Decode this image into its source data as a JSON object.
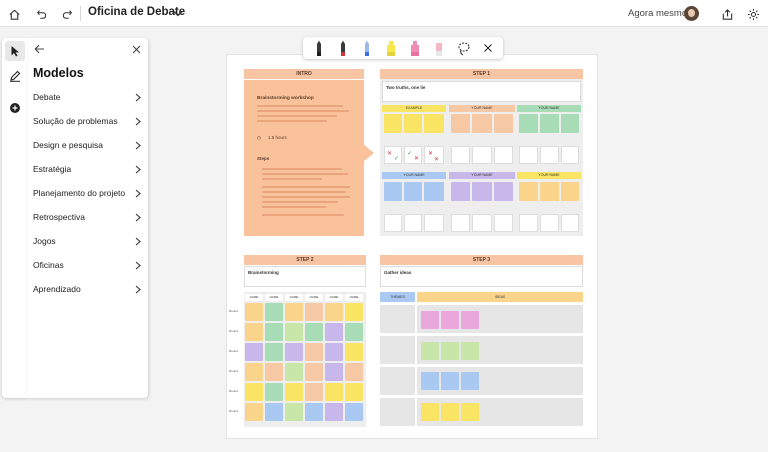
{
  "header": {
    "title": "Oficina de Debate",
    "saved_status": "Agora mesmo",
    "icons": [
      "home-icon",
      "undo-icon",
      "redo-icon",
      "chevron-down-icon",
      "share-icon",
      "gear-icon"
    ]
  },
  "toolrail": {
    "icons": [
      "select-arrow-icon",
      "pen-icon",
      "add-icon"
    ]
  },
  "panel": {
    "title": "Modelos",
    "categories": [
      "Debate",
      "Solução de problemas",
      "Design e pesquisa",
      "Estratégia",
      "Planejamento do projeto",
      "Retrospectiva",
      "Jogos",
      "Oficinas",
      "Aprendizado"
    ]
  },
  "pen_toolbar": {
    "tools": [
      "black-pen",
      "red-pen",
      "multicolor-pen",
      "yellow-highlighter",
      "pink-highlighter",
      "eraser",
      "lasso-select-icon",
      "close-icon"
    ],
    "colors": [
      "#1d1d1d",
      "#d13438",
      "#3f6fd8",
      "#f4e84a",
      "#f08bb7",
      "#f2b8c6"
    ]
  },
  "board": {
    "intro_header": "INTRO",
    "intro_title": "Brainstorming workshop",
    "intro_time": "1.5 hours",
    "intro_steps_label": "Steps",
    "step1_header": "STEP 1",
    "step1_title": "Two truths, one lie",
    "step1_example": "EXAMPLE",
    "step1_your_name": "YOUR NAME",
    "step2_header": "STEP 2",
    "step2_title": "Brainstorming",
    "step3_header": "STEP 3",
    "step3_title": "Gather ideas",
    "step3_themes": "THEMES",
    "step3_ideas": "IDEAS",
    "step2_col_label": "NAME",
    "step2_row_label": "Round",
    "colors": {
      "accent_orange": "#f7c5a3",
      "sticky_yellow": "#f9e463",
      "sticky_orange": "#f7c8a4",
      "sticky_green": "#a8dcb6",
      "sticky_blue": "#a9c9f2",
      "sticky_purple": "#c8b7ea",
      "sticky_pink": "#e9a7dc"
    }
  }
}
